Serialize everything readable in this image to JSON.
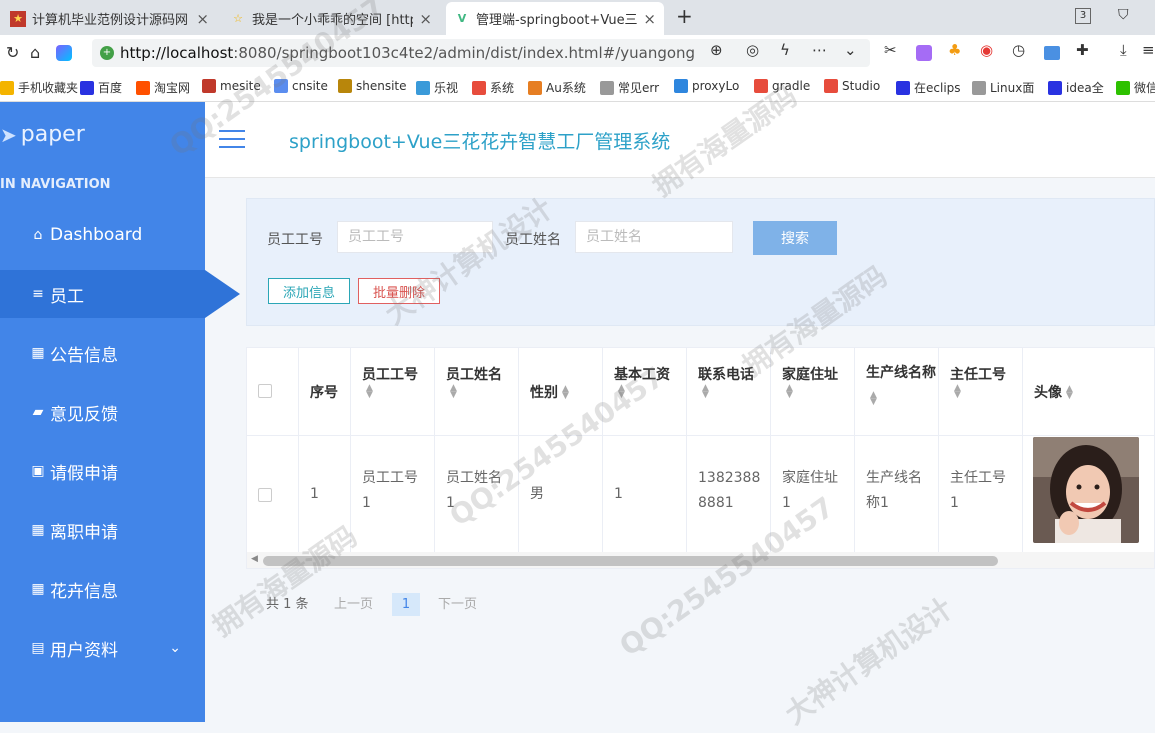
{
  "browser": {
    "tabs": [
      {
        "title": "计算机毕业范例设计源码网",
        "active": false
      },
      {
        "title": "我是一个小乖乖的空间 [http:/",
        "active": false
      },
      {
        "title": "管理端-springboot+Vue三花",
        "active": true
      }
    ],
    "tab_count": "3",
    "url_host": "http://localhost",
    "url_rest": ":8080/springboot103c4te2/admin/dist/index.html#/yuangong",
    "bookmarks": [
      "手机收藏夹",
      "百度",
      "淘宝网",
      "mesite",
      "cnsite",
      "shensite",
      "乐视",
      "系统",
      "Au系统",
      "常见err",
      "proxyLo",
      "gradle",
      "Studio",
      "在eclips",
      "Linux面",
      "idea全",
      "微信"
    ]
  },
  "sidebar": {
    "logo": "paper",
    "section_title": "IN NAVIGATION",
    "items": [
      {
        "label": "Dashboard",
        "icon": "home-icon"
      },
      {
        "label": "员工",
        "icon": "list-icon",
        "active": true
      },
      {
        "label": "公告信息",
        "icon": "grid-icon"
      },
      {
        "label": "意见反馈",
        "icon": "folder-icon"
      },
      {
        "label": "请假申请",
        "icon": "clipboard-icon"
      },
      {
        "label": "离职申请",
        "icon": "grid-icon"
      },
      {
        "label": "花卉信息",
        "icon": "grid-icon"
      },
      {
        "label": "用户资料",
        "icon": "calendar-icon"
      }
    ]
  },
  "header": {
    "title": "springboot+Vue三花花卉智慧工厂管理系统"
  },
  "search": {
    "emp_no_label": "员工工号",
    "emp_no_placeholder": "员工工号",
    "emp_name_label": "员工姓名",
    "emp_name_placeholder": "员工姓名",
    "search_button": "搜索",
    "add_button": "添加信息",
    "batch_delete_button": "批量删除"
  },
  "table": {
    "columns": [
      "序号",
      "员工工号",
      "员工姓名",
      "性别",
      "基本工资",
      "联系电话",
      "家庭住址",
      "生产线名称",
      "主任工号",
      "头像"
    ],
    "rows": [
      {
        "index": "1",
        "emp_no": "员工工号1",
        "emp_name": "员工姓名1",
        "gender": "男",
        "salary": "1",
        "phone": "13823888881",
        "address": "家庭住址1",
        "line_name": "生产线名称1",
        "director_no": "主任工号1"
      }
    ]
  },
  "pagination": {
    "total": "共 1 条",
    "prev": "上一页",
    "current": "1",
    "next": "下一页"
  },
  "watermarks": [
    "大神计算机设计",
    "拥有海量源码",
    "QQ:2545540457"
  ]
}
